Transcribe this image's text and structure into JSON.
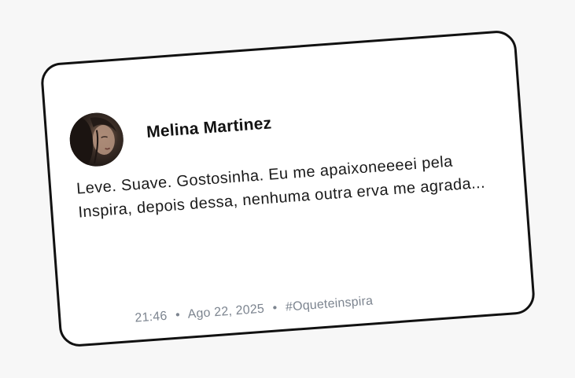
{
  "post": {
    "author_name": "Melina Martinez",
    "avatar_icon": "user-avatar-photo",
    "text": "Leve. Suave. Gostosinha. Eu me apaixoneeeei pela Inspira, depois dessa, nenhuma outra erva me agrada...",
    "time": "21:46",
    "date": "Ago 22, 2025",
    "hashtag": "#Oqueteinspira",
    "separator": "•"
  },
  "colors": {
    "background": "#f7f7f7",
    "card": "#ffffff",
    "border": "#111111",
    "text": "#1a1a1a",
    "meta": "#7d8590"
  }
}
